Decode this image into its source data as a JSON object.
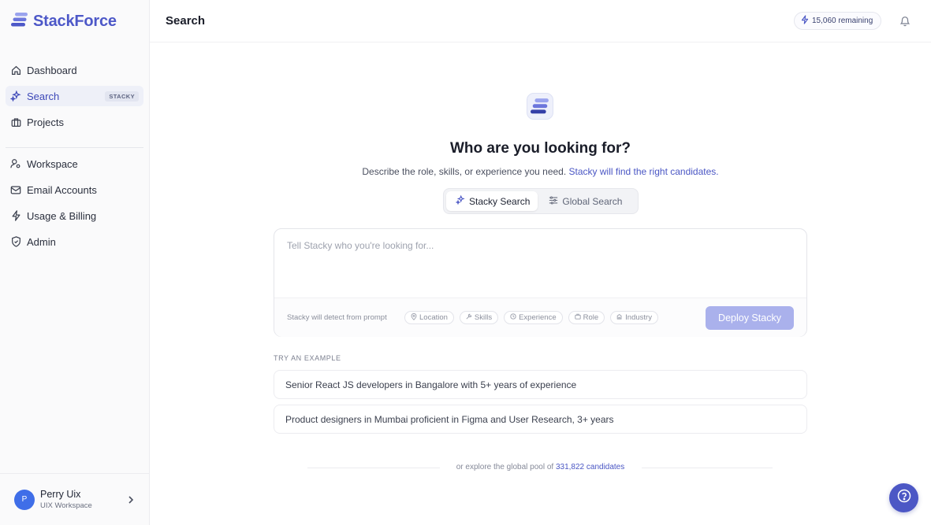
{
  "brand": {
    "name": "StackForce",
    "accent": "#4d58c8"
  },
  "sidebar": {
    "primary": [
      {
        "label": "Dashboard",
        "icon": "home-icon"
      },
      {
        "label": "Search",
        "icon": "sparkle-icon",
        "badge": "STACKY",
        "active": true
      },
      {
        "label": "Projects",
        "icon": "briefcase-icon"
      }
    ],
    "secondary": [
      {
        "label": "Workspace",
        "icon": "user-gear-icon"
      },
      {
        "label": "Email Accounts",
        "icon": "mail-icon"
      },
      {
        "label": "Usage & Billing",
        "icon": "bolt-icon"
      },
      {
        "label": "Admin",
        "icon": "shield-icon"
      }
    ],
    "user": {
      "initial": "P",
      "name": "Perry Uix",
      "workspace": "UIX Workspace"
    }
  },
  "header": {
    "title": "Search",
    "credits": "15,060 remaining"
  },
  "hero": {
    "title": "Who are you looking for?",
    "subtitle": "Describe the role, skills, or experience you need.",
    "subtitle_accent": "Stacky will find the right candidates."
  },
  "tabs": [
    {
      "label": "Stacky Search",
      "active": true
    },
    {
      "label": "Global Search",
      "active": false
    }
  ],
  "prompt": {
    "placeholder": "Tell Stacky who you're looking for...",
    "value": "",
    "detect_label": "Stacky will detect from prompt",
    "chips": [
      "Location",
      "Skills",
      "Experience",
      "Role",
      "Industry"
    ],
    "deploy_label": "Deploy Stacky"
  },
  "examples": {
    "label": "TRY AN EXAMPLE",
    "items": [
      "Senior React JS developers in Bangalore with 5+ years of experience",
      "Product designers in Mumbai proficient in Figma and User Research, 3+ years"
    ]
  },
  "explore": {
    "prefix": "or explore the global pool of",
    "link": "331,822 candidates"
  }
}
